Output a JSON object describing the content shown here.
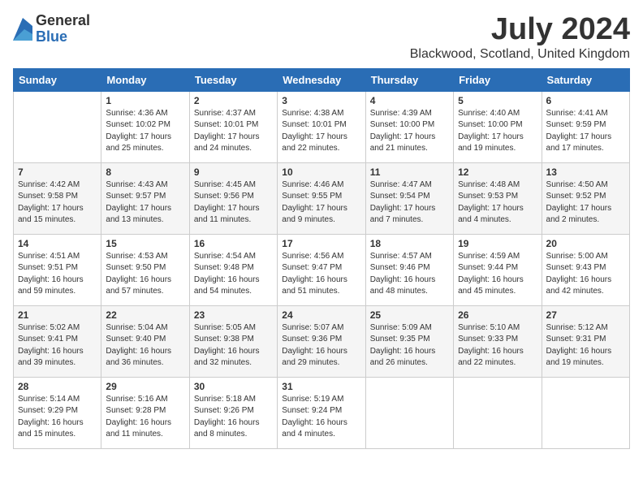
{
  "logo": {
    "general": "General",
    "blue": "Blue"
  },
  "title": "July 2024",
  "location": "Blackwood, Scotland, United Kingdom",
  "days_of_week": [
    "Sunday",
    "Monday",
    "Tuesday",
    "Wednesday",
    "Thursday",
    "Friday",
    "Saturday"
  ],
  "weeks": [
    [
      {
        "day": "",
        "info": ""
      },
      {
        "day": "1",
        "info": "Sunrise: 4:36 AM\nSunset: 10:02 PM\nDaylight: 17 hours\nand 25 minutes."
      },
      {
        "day": "2",
        "info": "Sunrise: 4:37 AM\nSunset: 10:01 PM\nDaylight: 17 hours\nand 24 minutes."
      },
      {
        "day": "3",
        "info": "Sunrise: 4:38 AM\nSunset: 10:01 PM\nDaylight: 17 hours\nand 22 minutes."
      },
      {
        "day": "4",
        "info": "Sunrise: 4:39 AM\nSunset: 10:00 PM\nDaylight: 17 hours\nand 21 minutes."
      },
      {
        "day": "5",
        "info": "Sunrise: 4:40 AM\nSunset: 10:00 PM\nDaylight: 17 hours\nand 19 minutes."
      },
      {
        "day": "6",
        "info": "Sunrise: 4:41 AM\nSunset: 9:59 PM\nDaylight: 17 hours\nand 17 minutes."
      }
    ],
    [
      {
        "day": "7",
        "info": "Sunrise: 4:42 AM\nSunset: 9:58 PM\nDaylight: 17 hours\nand 15 minutes."
      },
      {
        "day": "8",
        "info": "Sunrise: 4:43 AM\nSunset: 9:57 PM\nDaylight: 17 hours\nand 13 minutes."
      },
      {
        "day": "9",
        "info": "Sunrise: 4:45 AM\nSunset: 9:56 PM\nDaylight: 17 hours\nand 11 minutes."
      },
      {
        "day": "10",
        "info": "Sunrise: 4:46 AM\nSunset: 9:55 PM\nDaylight: 17 hours\nand 9 minutes."
      },
      {
        "day": "11",
        "info": "Sunrise: 4:47 AM\nSunset: 9:54 PM\nDaylight: 17 hours\nand 7 minutes."
      },
      {
        "day": "12",
        "info": "Sunrise: 4:48 AM\nSunset: 9:53 PM\nDaylight: 17 hours\nand 4 minutes."
      },
      {
        "day": "13",
        "info": "Sunrise: 4:50 AM\nSunset: 9:52 PM\nDaylight: 17 hours\nand 2 minutes."
      }
    ],
    [
      {
        "day": "14",
        "info": "Sunrise: 4:51 AM\nSunset: 9:51 PM\nDaylight: 16 hours\nand 59 minutes."
      },
      {
        "day": "15",
        "info": "Sunrise: 4:53 AM\nSunset: 9:50 PM\nDaylight: 16 hours\nand 57 minutes."
      },
      {
        "day": "16",
        "info": "Sunrise: 4:54 AM\nSunset: 9:48 PM\nDaylight: 16 hours\nand 54 minutes."
      },
      {
        "day": "17",
        "info": "Sunrise: 4:56 AM\nSunset: 9:47 PM\nDaylight: 16 hours\nand 51 minutes."
      },
      {
        "day": "18",
        "info": "Sunrise: 4:57 AM\nSunset: 9:46 PM\nDaylight: 16 hours\nand 48 minutes."
      },
      {
        "day": "19",
        "info": "Sunrise: 4:59 AM\nSunset: 9:44 PM\nDaylight: 16 hours\nand 45 minutes."
      },
      {
        "day": "20",
        "info": "Sunrise: 5:00 AM\nSunset: 9:43 PM\nDaylight: 16 hours\nand 42 minutes."
      }
    ],
    [
      {
        "day": "21",
        "info": "Sunrise: 5:02 AM\nSunset: 9:41 PM\nDaylight: 16 hours\nand 39 minutes."
      },
      {
        "day": "22",
        "info": "Sunrise: 5:04 AM\nSunset: 9:40 PM\nDaylight: 16 hours\nand 36 minutes."
      },
      {
        "day": "23",
        "info": "Sunrise: 5:05 AM\nSunset: 9:38 PM\nDaylight: 16 hours\nand 32 minutes."
      },
      {
        "day": "24",
        "info": "Sunrise: 5:07 AM\nSunset: 9:36 PM\nDaylight: 16 hours\nand 29 minutes."
      },
      {
        "day": "25",
        "info": "Sunrise: 5:09 AM\nSunset: 9:35 PM\nDaylight: 16 hours\nand 26 minutes."
      },
      {
        "day": "26",
        "info": "Sunrise: 5:10 AM\nSunset: 9:33 PM\nDaylight: 16 hours\nand 22 minutes."
      },
      {
        "day": "27",
        "info": "Sunrise: 5:12 AM\nSunset: 9:31 PM\nDaylight: 16 hours\nand 19 minutes."
      }
    ],
    [
      {
        "day": "28",
        "info": "Sunrise: 5:14 AM\nSunset: 9:29 PM\nDaylight: 16 hours\nand 15 minutes."
      },
      {
        "day": "29",
        "info": "Sunrise: 5:16 AM\nSunset: 9:28 PM\nDaylight: 16 hours\nand 11 minutes."
      },
      {
        "day": "30",
        "info": "Sunrise: 5:18 AM\nSunset: 9:26 PM\nDaylight: 16 hours\nand 8 minutes."
      },
      {
        "day": "31",
        "info": "Sunrise: 5:19 AM\nSunset: 9:24 PM\nDaylight: 16 hours\nand 4 minutes."
      },
      {
        "day": "",
        "info": ""
      },
      {
        "day": "",
        "info": ""
      },
      {
        "day": "",
        "info": ""
      }
    ]
  ]
}
